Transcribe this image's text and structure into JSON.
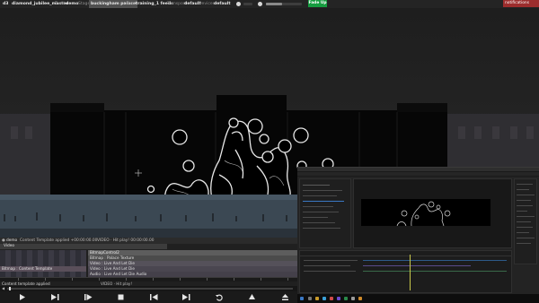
{
  "topbar": {
    "badge": "d3",
    "project": "diamond_jubilee_master",
    "track_label": "Track",
    "track_value": "demo",
    "stage_label": "Stage",
    "stage_value": "buckingham palace",
    "feed_label": "Feed",
    "feed_value": "training_1 feeds",
    "transport_label": "Transport",
    "transport_value": "default",
    "devices_label": "Devices",
    "devices_value": "default",
    "fade_up": "Fade Up",
    "notifications": "notifications",
    "volume_level": 0.45
  },
  "colors": {
    "fade_up_bg": "#169c40",
    "notification_bg": "#9c2d2d",
    "track_row_active": "#55515a",
    "ae_accent": "#3a78c4"
  },
  "deck": {
    "header_track": "demo",
    "header_status": "Content Template applied +00:00:00.00",
    "header_video": "VIDEO · Hit play! 00:00:00.00",
    "video_track": "Video",
    "layers": [
      {
        "label": "BitmapControl2"
      },
      {
        "label": "Bitmap : Palace Texture"
      },
      {
        "label": "Video : Live And Let Die"
      },
      {
        "label": "Video : Live And Let Die"
      },
      {
        "label": "Audio : Live And Let Die Audio"
      }
    ],
    "content_template_row": "Bitmap : Content Template",
    "status_left": "Content template applied",
    "status_center": "VIDEO · Hit play!"
  },
  "transport": {
    "buttons": [
      {
        "name": "play-icon"
      },
      {
        "name": "play-to-end-icon"
      },
      {
        "name": "play-section-icon"
      },
      {
        "name": "stop-icon"
      },
      {
        "name": "previous-section-icon"
      },
      {
        "name": "next-section-icon"
      },
      {
        "name": "return-icon"
      },
      {
        "name": "cue-up-icon"
      },
      {
        "name": "eject-icon"
      }
    ]
  }
}
